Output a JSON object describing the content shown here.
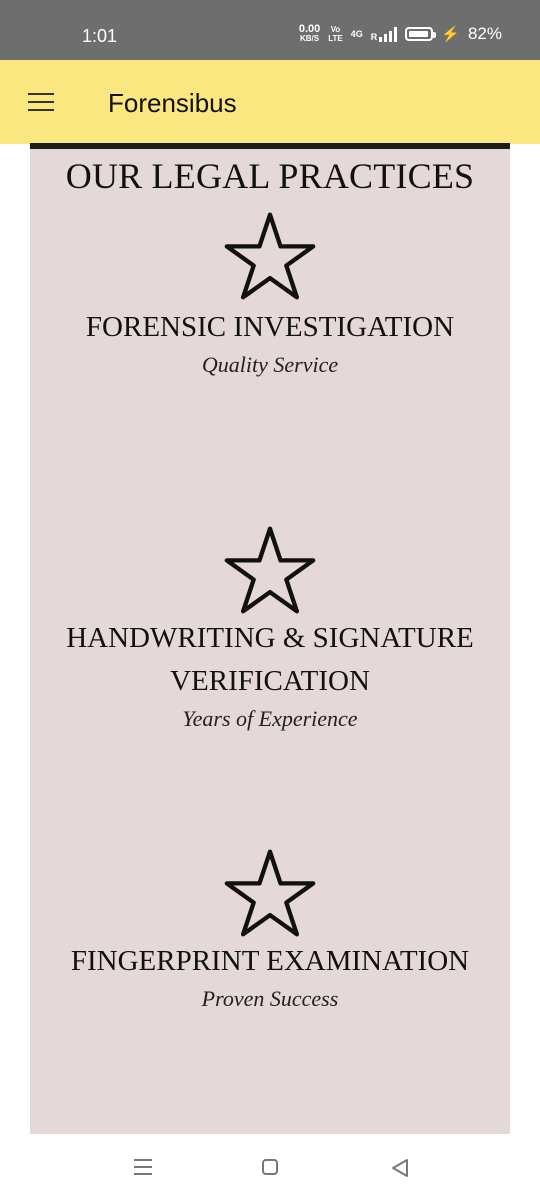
{
  "status_bar": {
    "time": "1:01",
    "speed_value": "0.00",
    "speed_unit": "KB/S",
    "volte_top": "Vo",
    "volte_bottom": "LTE",
    "network": "4G",
    "signal_label": "R",
    "battery_percent": "82%",
    "battery_level": 0.82
  },
  "app_bar": {
    "title": "Forensibus",
    "menu_icon": "hamburger-menu-icon",
    "background": "#fbe77f"
  },
  "section": {
    "title": "OUR LEGAL PRACTICES",
    "background": "#e4d8d8"
  },
  "practices": [
    {
      "name_line1": "FORENSIC INVESTIGATION",
      "name_line2": "",
      "subtitle": "Quality Service",
      "icon": "star-outline-icon"
    },
    {
      "name_line1": "HANDWRITING & SIGNATURE",
      "name_line2": "VERIFICATION",
      "subtitle": "Years of Experience",
      "icon": "star-outline-icon"
    },
    {
      "name_line1": "FINGERPRINT EXAMINATION",
      "name_line2": "",
      "subtitle": "Proven Success",
      "icon": "star-outline-icon"
    }
  ],
  "nav_bar": {
    "recents_icon": "recents-icon",
    "home_icon": "home-icon",
    "back_icon": "back-icon"
  }
}
